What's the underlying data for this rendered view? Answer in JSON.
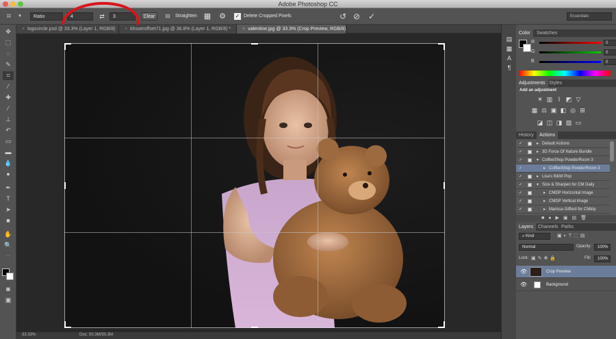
{
  "window": {
    "title": "Adobe Photoshop CC"
  },
  "options_bar": {
    "preset": "Ratio",
    "width_value": "4",
    "height_value": "3",
    "clear_label": "Clear",
    "straighten_label": "Straighten",
    "delete_cropped_label": "Delete Cropped Pixels",
    "workspace": "Essentials"
  },
  "tabs": [
    {
      "label": "logocircle.psd @ 33.3% (Layer 1, RGB/8)"
    },
    {
      "label": "khsseroffset71.jpg @ 36.8% (Layer 1, RGB/8) *"
    },
    {
      "label": "valentine.jpg @ 33.3% (Crop Preview, RGB/8)"
    }
  ],
  "status": {
    "zoom": "33.33%",
    "doc": "Doc: 50.3M/50.3M"
  },
  "color_panel": {
    "tabs": [
      "Color",
      "Swatches"
    ],
    "channels": [
      {
        "label": "R",
        "value": "0"
      },
      {
        "label": "G",
        "value": "0"
      },
      {
        "label": "B",
        "value": "0"
      }
    ]
  },
  "adjustments_panel": {
    "tabs": [
      "Adjustments",
      "Styles"
    ],
    "heading": "Add an adjustment"
  },
  "actions_panel": {
    "tabs": [
      "History",
      "Actions"
    ],
    "rows": [
      {
        "label": "Default Actions"
      },
      {
        "label": "3D Force Of Nature Bundle"
      },
      {
        "label": "CoffeeShop PowderRoom 3"
      },
      {
        "label": "CoffeeShop PowderRoom 3"
      },
      {
        "label": "Lisa's B&W Pop"
      },
      {
        "label": "Size & Sharpen for CM Daily"
      },
      {
        "label": "CMDP Horizontal Image"
      },
      {
        "label": "CMDP Vertical Image"
      },
      {
        "label": "Marissa Gifford for CMtrip"
      }
    ]
  },
  "layers_panel": {
    "tabs": [
      "Layers",
      "Channels",
      "Paths"
    ],
    "kind": "Kind",
    "blend_mode": "Normal",
    "opacity_label": "Opacity:",
    "opacity_value": "100%",
    "lock_label": "Lock:",
    "fill_label": "Fill:",
    "fill_value": "100%",
    "layers": [
      {
        "name": "Crop Preview"
      },
      {
        "name": "Background"
      }
    ]
  }
}
